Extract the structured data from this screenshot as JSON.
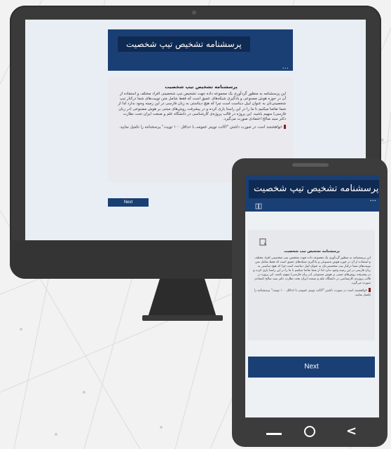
{
  "colors": {
    "header_blue": "#1a3f74",
    "title_box_blue": "#0f2a53",
    "device_body": "#3a3a3a",
    "note_mark": "#8b1a1a"
  },
  "form": {
    "title": "پرسشنامه تشخیص تیپ شخصیت",
    "card_title": "پرسشنامه تشخیص تیپ شخصیت",
    "description": "این پرسشنامه به منظور گردآوری یک مجموعه داده جهت تشخیص تیپ شخصیتی افراد مختلف و استفاده از آن در حوزه هوش مصنوعی و یادگیری شبکه‌های عمیق است که فقط شامل متن توییت‌های شما درکنار تیپ شخصیتی‌تان به عنوان لیبل دیتاست است چرا که هیچ دیتاستی به زبان فارسی در این زمینه وجود ندارد لذا از شما تقاضا میکنیم تا ما را در این راستا یاری کرده و در پیشرفت روش‌های مبتنی بر هوش مصنوعی (در زبان فارسی) سهیم باشید. این پروژه در قالب پروژه‌ی کارشناسی در دانشگاه علم و صنعت ایران تحت نظارت دکتر سید صالح اعتمادی صورت می‌گیرد.",
    "note": "خواهشمند است در صورت داشتن \"اکانت توییتر عمومی با حداقل ۱۰۰ توییت\" پرسشنامه را تکمیل نمایید.",
    "next_label": "Next",
    "menu_dots": "..."
  },
  "icons": {
    "book": "book-icon",
    "form_icon": "form-icon",
    "nav_back": "back-icon",
    "nav_home": "home-icon",
    "nav_recent": "recent-apps-icon"
  }
}
